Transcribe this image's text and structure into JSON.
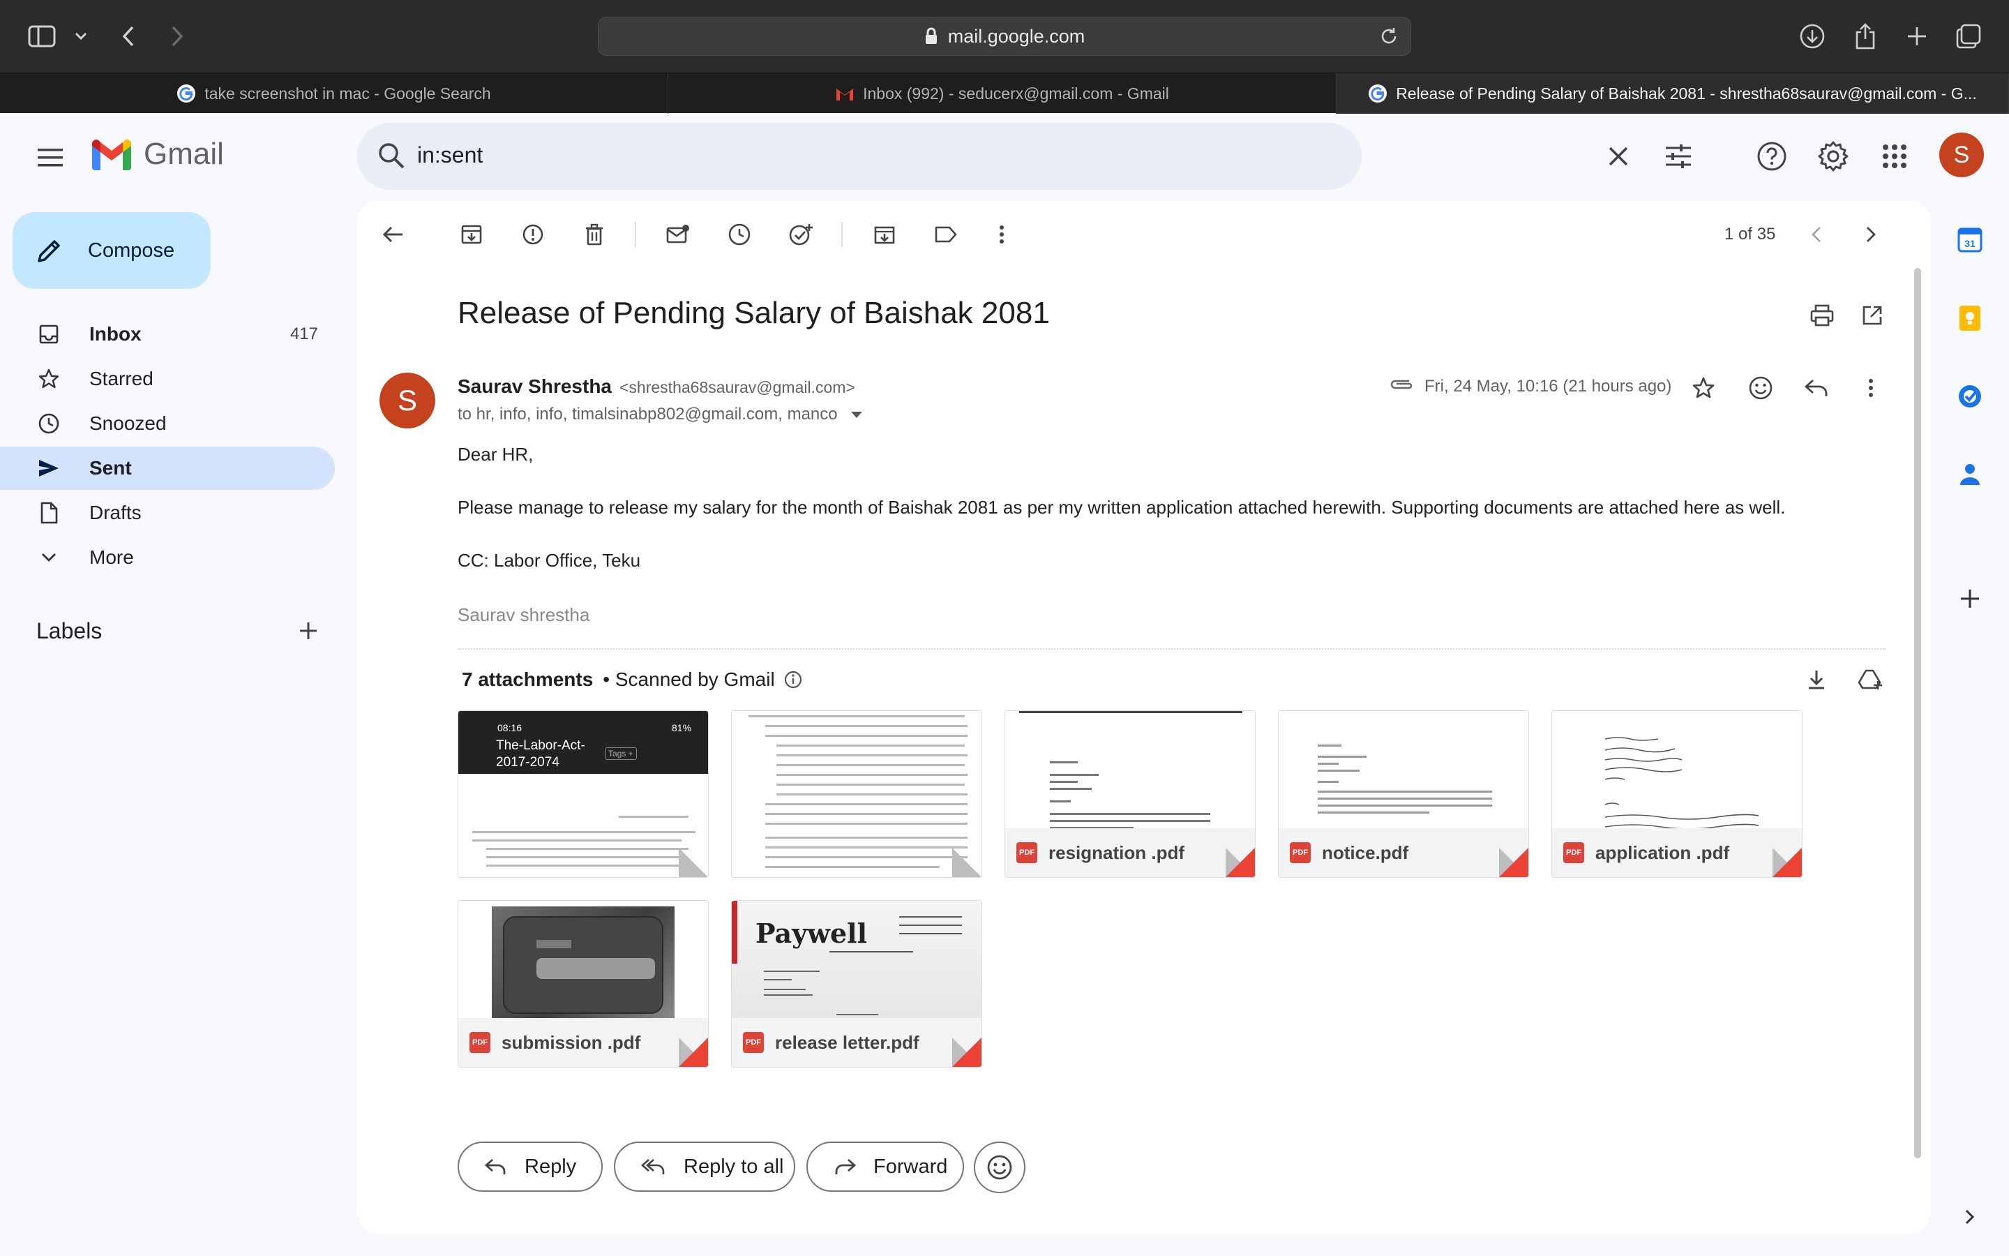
{
  "browser": {
    "url": "mail.google.com",
    "tabs": [
      {
        "title": "take screenshot in mac - Google Search"
      },
      {
        "title": "Inbox (992) - seducerx@gmail.com - Gmail"
      },
      {
        "title": "Release of Pending Salary of Baishak 2081 - shrestha68saurav@gmail.com - G..."
      }
    ]
  },
  "header": {
    "logo_text": "Gmail",
    "search_value": "in:sent",
    "avatar_letter": "S"
  },
  "sidebar": {
    "compose_label": "Compose",
    "items": [
      {
        "label": "Inbox",
        "count": "417"
      },
      {
        "label": "Starred",
        "count": ""
      },
      {
        "label": "Snoozed",
        "count": ""
      },
      {
        "label": "Sent",
        "count": ""
      },
      {
        "label": "Drafts",
        "count": ""
      },
      {
        "label": "More",
        "count": ""
      }
    ],
    "labels_heading": "Labels"
  },
  "toolbar": {
    "pager": "1 of 35"
  },
  "email": {
    "subject": "Release of Pending Salary of Baishak 2081",
    "sender_name": "Saurav Shrestha",
    "sender_email": "<shrestha68saurav@gmail.com>",
    "recipients": "to hr, info, info, timalsinabp802@gmail.com, manco",
    "date": "Fri, 24 May, 10:16 (21 hours ago)",
    "avatar_letter": "S",
    "body": [
      "Dear HR,",
      "Please manage to release my salary for the month of Baishak 2081 as per my written application attached herewith. Supporting documents are attached here as well.",
      "CC: Labor Office, Teku"
    ],
    "signature": "Saurav shrestha"
  },
  "attachments": {
    "count_label": "7 attachments",
    "scanned_label": "• Scanned by Gmail",
    "items": [
      {
        "name": "",
        "preview_title": "The-Labor-Act-2017-2074",
        "preview_time": "08:16",
        "preview_battery": "81%",
        "preview_tags": "Tags +"
      },
      {
        "name": ""
      },
      {
        "name": "resignation .pdf"
      },
      {
        "name": "notice.pdf"
      },
      {
        "name": "application .pdf"
      },
      {
        "name": "submission .pdf"
      },
      {
        "name": "release letter.pdf",
        "preview_logo": "Paywell"
      }
    ],
    "pdf_badge": "PDF"
  },
  "actions": {
    "reply": "Reply",
    "reply_all": "Reply to all",
    "forward": "Forward"
  },
  "colors": {
    "accent_blue": "#0b57d0",
    "compose_bg": "#c2e7ff",
    "active_nav": "#d3e3fd",
    "avatar": "#c5421f",
    "pdf_red": "#db4437"
  }
}
